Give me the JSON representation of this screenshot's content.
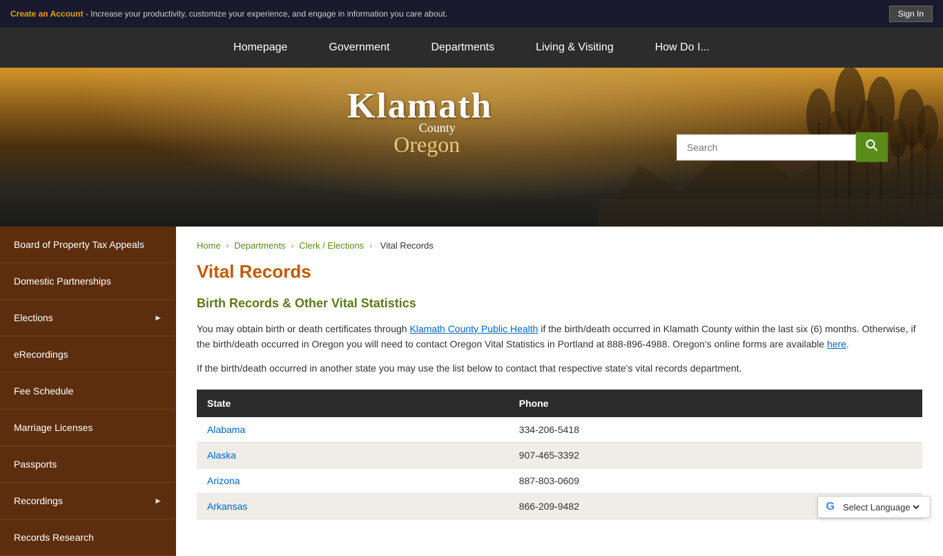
{
  "topbar": {
    "create_account_text": "Create an Account",
    "tagline": " - Increase your productivity, customize your experience, and engage in information you care about.",
    "sign_in": "Sign In"
  },
  "nav": {
    "items": [
      {
        "label": "Homepage",
        "id": "homepage"
      },
      {
        "label": "Government",
        "id": "government"
      },
      {
        "label": "Departments",
        "id": "departments"
      },
      {
        "label": "Living & Visiting",
        "id": "living-visiting"
      },
      {
        "label": "How Do I...",
        "id": "how-do-i"
      }
    ]
  },
  "logo": {
    "klamath": "Klamath",
    "county": "County",
    "oregon": "Oregon"
  },
  "search": {
    "placeholder": "Search",
    "button_label": "🔍"
  },
  "sidebar": {
    "items": [
      {
        "label": "Board of Property Tax Appeals",
        "arrow": false
      },
      {
        "label": "Domestic Partnerships",
        "arrow": false
      },
      {
        "label": "Elections",
        "arrow": true
      },
      {
        "label": "eRecordings",
        "arrow": false
      },
      {
        "label": "Fee Schedule",
        "arrow": false
      },
      {
        "label": "Marriage Licenses",
        "arrow": false
      },
      {
        "label": "Passports",
        "arrow": false
      },
      {
        "label": "Recordings",
        "arrow": true
      },
      {
        "label": "Records Research",
        "arrow": false
      }
    ]
  },
  "breadcrumb": {
    "items": [
      {
        "label": "Home",
        "link": true
      },
      {
        "label": "Departments",
        "link": true
      },
      {
        "label": "Clerk / Elections",
        "link": true
      },
      {
        "label": "Vital Records",
        "link": false
      }
    ]
  },
  "page": {
    "title": "Vital Records",
    "section_title": "Birth Records & Other Vital Statistics",
    "para1": "You may obtain birth or death certificates through ",
    "klamath_link": "Klamath County Public Health",
    "para1_cont": " if the birth/death occurred in Klamath County within the last six (6) months. Otherwise, if the birth/death occurred in Oregon you will need to contact Oregon Vital Statistics in Portland at 888-896-4988. Oregon's online forms are available ",
    "here_link": "here",
    "para1_end": ".",
    "para2": "If the birth/death occurred in another state you may use the list below to contact that respective state's vital records department.",
    "table": {
      "headers": [
        "State",
        "Phone"
      ],
      "rows": [
        {
          "state": "Alabama",
          "phone": "334-206-5418"
        },
        {
          "state": "Alaska",
          "phone": "907-465-3392"
        },
        {
          "state": "Arizona",
          "phone": "887-803-0609"
        },
        {
          "state": "Arkansas",
          "phone": "866-209-9482"
        }
      ]
    }
  },
  "translate": {
    "label": "Select Language",
    "g_letter": "G"
  }
}
